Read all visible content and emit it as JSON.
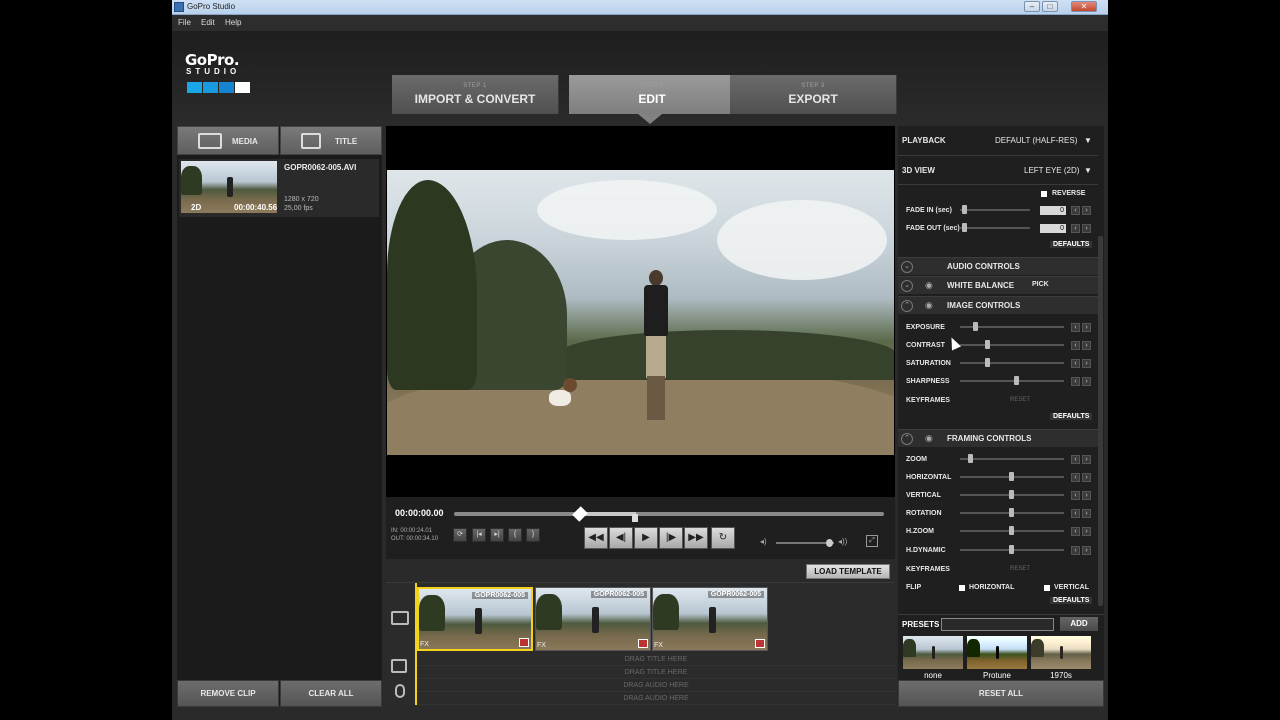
{
  "window": {
    "title": "GoPro Studio",
    "min": "–",
    "max": "□",
    "close": "✕"
  },
  "menu": [
    "File",
    "Edit",
    "Help"
  ],
  "logo": {
    "text": "GoPro.",
    "sub": "STUDIO"
  },
  "steps": [
    {
      "num": "STEP 1",
      "name": "IMPORT & CONVERT",
      "active": false
    },
    {
      "num": "STEP 2",
      "name": "EDIT",
      "active": true
    },
    {
      "num": "STEP 3",
      "name": "EXPORT",
      "active": false
    }
  ],
  "left": {
    "tabs": {
      "media": "MEDIA",
      "title": "TITLE"
    },
    "clip": {
      "name": "GOPR0062-005.AVI",
      "resolution": "1280 x 720",
      "fps": "25,00 fps",
      "mode": "2D",
      "duration": "00:00:40.56"
    },
    "remove_clip": "REMOVE CLIP",
    "clear_all": "CLEAR ALL"
  },
  "transport": {
    "timecode": "00:00:00.00",
    "in": "IN: 00:00:24.01",
    "out": "OUT: 00:00:34.10",
    "edit_buttons": [
      "⟳",
      "|◂",
      "▸|",
      "{",
      "}"
    ],
    "play_buttons": [
      "◀◀",
      "◀|",
      "▶",
      "|▶",
      "▶▶",
      "↻"
    ],
    "vol_low": "◂)",
    "vol_high": "◂))",
    "fullscreen": "⤢",
    "load_template": "LOAD TEMPLATE"
  },
  "timeline": {
    "clips": [
      {
        "name": "GOPR0062-005",
        "fx": "FX",
        "selected": true
      },
      {
        "name": "GOPR0062-005",
        "fx": "FX",
        "selected": false
      },
      {
        "name": "GOPR0062-005",
        "fx": "FX",
        "selected": false
      }
    ],
    "drag_rows": [
      "DRAG TITLE HERE",
      "DRAG TITLE HERE",
      "DRAG AUDIO HERE",
      "DRAG AUDIO HERE"
    ]
  },
  "right": {
    "playback_label": "PLAYBACK",
    "playback_value": "DEFAULT (HALF-RES)",
    "view3d_label": "3D VIEW",
    "view3d_value": "LEFT EYE (2D)",
    "reverse": "REVERSE",
    "fade_in": "FADE IN (sec)",
    "fade_out": "FADE OUT (sec)",
    "fade_in_val": "0",
    "fade_out_val": "0",
    "defaults": "DEFAULTS",
    "sections": {
      "audio": "AUDIO CONTROLS",
      "white_balance": "WHITE BALANCE",
      "pick": "PICK",
      "image": "IMAGE CONTROLS",
      "framing": "FRAMING CONTROLS"
    },
    "image_controls": [
      "EXPOSURE",
      "CONTRAST",
      "SATURATION",
      "SHARPNESS",
      "KEYFRAMES"
    ],
    "framing_controls": [
      "ZOOM",
      "HORIZONTAL",
      "VERTICAL",
      "ROTATION",
      "H.ZOOM",
      "H.DYNAMIC",
      "KEYFRAMES"
    ],
    "reset": "RESET",
    "flip_label": "FLIP",
    "flip_h": "HORIZONTAL",
    "flip_v": "VERTICAL"
  },
  "presets": {
    "label": "PRESETS",
    "add": "ADD",
    "items": [
      "none",
      "Protune",
      "1970s"
    ],
    "reset_all": "RESET ALL"
  },
  "colors": {
    "accent_yellow": "#f2d21b",
    "logo_blue": "#1aa7e8"
  }
}
